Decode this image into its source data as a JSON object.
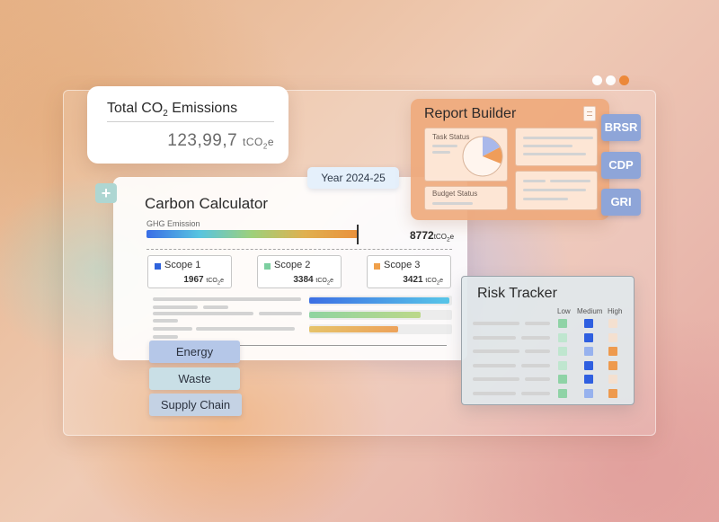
{
  "window": {
    "dots": [
      "#ffffff",
      "#ffffff",
      "#ee8a3a"
    ]
  },
  "total_emissions": {
    "title_prefix": "Total CO",
    "title_sub": "2",
    "title_suffix": " Emissions",
    "value": "123,99,7",
    "unit_prefix": "tCO",
    "unit_sub": "2",
    "unit_suffix": "e"
  },
  "calculator": {
    "title": "Carbon Calculator",
    "year": "Year 2024-25",
    "ghg_label": "GHG Emission",
    "ghg_value": "8772",
    "ghg_fraction": 0.69,
    "unit_prefix": "tCO",
    "unit_sub": "2",
    "unit_suffix": "e",
    "scopes": [
      {
        "name": "Scope 1",
        "value": "1967",
        "color": "#2f63dc"
      },
      {
        "name": "Scope 2",
        "value": "3384",
        "color": "#7ccfa0"
      },
      {
        "name": "Scope 3",
        "value": "3421",
        "color": "#f0a04a"
      }
    ],
    "bars": [
      {
        "fraction": 0.98,
        "gradient": "linear-gradient(90deg,#3c6fe4,#58c6e8)"
      },
      {
        "fraction": 0.78,
        "gradient": "linear-gradient(90deg,#8fd4a0,#bcd88a)"
      },
      {
        "fraction": 0.62,
        "gradient": "linear-gradient(90deg,#e6c36a,#eda25a)"
      }
    ],
    "categories": [
      {
        "label": "Energy",
        "color": "#b5c7e8"
      },
      {
        "label": "Waste",
        "color": "#c9dfe6"
      },
      {
        "label": "Supply Chain",
        "color": "#c4d2e4"
      }
    ]
  },
  "report_builder": {
    "title": "Report Builder",
    "task_status": "Task Status",
    "budget_status": "Budget Status",
    "tags": [
      "BRSR",
      "CDP",
      "GRI"
    ]
  },
  "risk_tracker": {
    "title": "Risk Tracker",
    "headers": [
      "Low",
      "Medium",
      "High"
    ],
    "rows": [
      [
        "#8fd3a6",
        "#2f5fe0",
        "#f4e0d0"
      ],
      [
        "#bfe6cf",
        "#2f5fe0",
        "#f4e0d0"
      ],
      [
        "#bfe6cf",
        "#97b2ee",
        "#ee9a4e"
      ],
      [
        "#bfe6cf",
        "#2f5fe0",
        "#ee9a4e"
      ],
      [
        "#8fd3a6",
        "#2f5fe0",
        "#f4e0d0"
      ],
      [
        "#8fd3a6",
        "#97b2ee",
        "#ee9a4e"
      ]
    ]
  }
}
